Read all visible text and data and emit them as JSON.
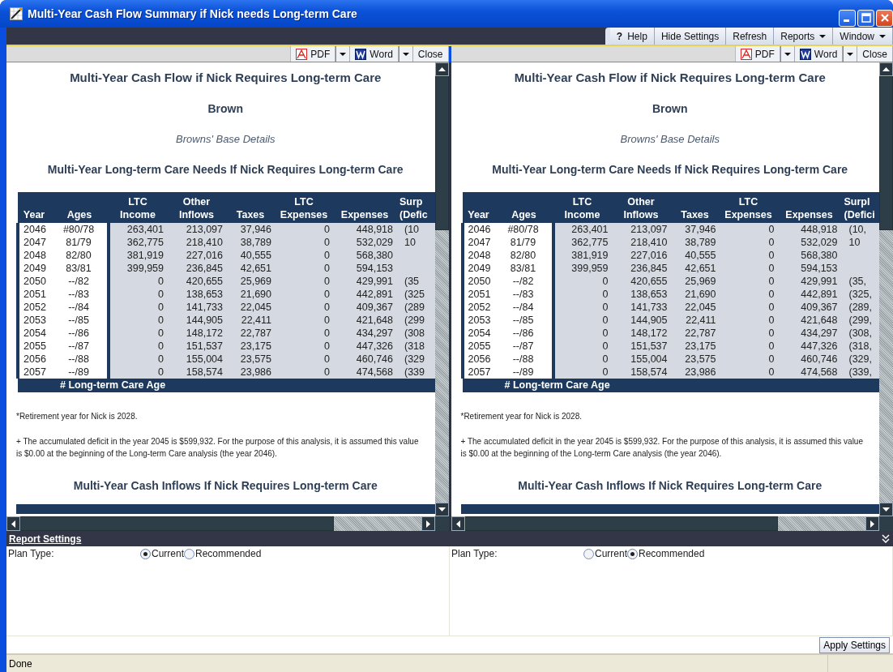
{
  "window": {
    "title": "Multi-Year Cash Flow Summary if Nick needs Long-term Care"
  },
  "menu": [
    {
      "label": "Help",
      "icon": "?",
      "dropdown": false
    },
    {
      "label": "Hide Settings",
      "dropdown": false
    },
    {
      "label": "Refresh",
      "dropdown": false
    },
    {
      "label": "Reports",
      "dropdown": true
    },
    {
      "label": "Window",
      "dropdown": true
    }
  ],
  "panes": [
    {
      "toolbar": [
        {
          "kind": "pdf",
          "label": "PDF"
        },
        {
          "kind": "word",
          "label": "Word"
        },
        {
          "kind": "plain",
          "label": "Close"
        }
      ],
      "report": {
        "title": "Multi-Year Cash Flow if Nick Requires Long-term Care",
        "client": "Brown",
        "subtitle": "Browns' Base Details",
        "section_title": "Multi-Year Long-term Care Needs If Nick Requires Long-term Care",
        "table": {
          "columns": [
            {
              "label": "Year"
            },
            {
              "label": "Ages"
            },
            {
              "top": "LTC",
              "label": "Income"
            },
            {
              "top": "Other",
              "label": "Inflows"
            },
            {
              "label": "Taxes"
            },
            {
              "top": "LTC",
              "label": "Expenses"
            },
            {
              "label": "Expenses"
            },
            {
              "top": "Surp",
              "label": "(Defic"
            }
          ],
          "rows": [
            [
              "2046",
              "#80/78",
              "263,401",
              "213,097",
              "37,946",
              "0",
              "448,918",
              "(10"
            ],
            [
              "2047",
              "81/79",
              "362,775",
              "218,410",
              "38,789",
              "0",
              "532,029",
              "10"
            ],
            [
              "2048",
              "82/80",
              "381,919",
              "227,016",
              "40,555",
              "0",
              "568,380",
              ""
            ],
            [
              "2049",
              "83/81",
              "399,959",
              "236,845",
              "42,651",
              "0",
              "594,153",
              ""
            ],
            [
              "2050",
              "--/82",
              "0",
              "420,655",
              "25,969",
              "0",
              "429,991",
              "(35"
            ],
            [
              "2051",
              "--/83",
              "0",
              "138,653",
              "21,690",
              "0",
              "442,891",
              "(325"
            ],
            [
              "2052",
              "--/84",
              "0",
              "141,733",
              "22,045",
              "0",
              "409,367",
              "(289"
            ],
            [
              "2053",
              "--/85",
              "0",
              "144,905",
              "22,411",
              "0",
              "421,648",
              "(299"
            ],
            [
              "2054",
              "--/86",
              "0",
              "148,172",
              "22,787",
              "0",
              "434,297",
              "(308"
            ],
            [
              "2055",
              "--/87",
              "0",
              "151,537",
              "23,175",
              "0",
              "447,326",
              "(318"
            ],
            [
              "2056",
              "--/88",
              "0",
              "155,004",
              "23,575",
              "0",
              "460,746",
              "(329"
            ],
            [
              "2057",
              "--/89",
              "0",
              "158,574",
              "23,986",
              "0",
              "474,568",
              "(339"
            ]
          ],
          "footer": "# Long-term Care Age"
        },
        "notes": [
          "*Retirement year for Nick is 2028.",
          "+ The accumulated deficit in the year 2045 is $599,932. For the purpose of this analysis, it is assumed this value is $0.00 at the beginning of the Long-term Care analysis (the year 2046)."
        ],
        "next_section_title": "Multi-Year Cash Inflows If Nick Requires Long-term Care"
      },
      "settings": {
        "label": "Plan Type:",
        "options": [
          {
            "label": "Current",
            "selected": true
          },
          {
            "label": "Recommended",
            "selected": false
          }
        ]
      }
    },
    {
      "toolbar": [
        {
          "kind": "pdf",
          "label": "PDF"
        },
        {
          "kind": "word",
          "label": "Word"
        },
        {
          "kind": "plain",
          "label": "Close"
        }
      ],
      "report": {
        "title": "Multi-Year Cash Flow if Nick Requires Long-term Care",
        "client": "Brown",
        "subtitle": "Browns' Base Details",
        "section_title": "Multi-Year Long-term Care Needs If Nick Requires Long-term Care",
        "table": {
          "columns": [
            {
              "label": "Year"
            },
            {
              "label": "Ages"
            },
            {
              "top": "LTC",
              "label": "Income"
            },
            {
              "top": "Other",
              "label": "Inflows"
            },
            {
              "label": "Taxes"
            },
            {
              "top": "LTC",
              "label": "Expenses"
            },
            {
              "label": "Expenses"
            },
            {
              "top": "Surpl",
              "label": "(Defici"
            }
          ],
          "rows": [
            [
              "2046",
              "#80/78",
              "263,401",
              "213,097",
              "37,946",
              "0",
              "448,918",
              "(10,"
            ],
            [
              "2047",
              "81/79",
              "362,775",
              "218,410",
              "38,789",
              "0",
              "532,029",
              "10"
            ],
            [
              "2048",
              "82/80",
              "381,919",
              "227,016",
              "40,555",
              "0",
              "568,380",
              ""
            ],
            [
              "2049",
              "83/81",
              "399,959",
              "236,845",
              "42,651",
              "0",
              "594,153",
              ""
            ],
            [
              "2050",
              "--/82",
              "0",
              "420,655",
              "25,969",
              "0",
              "429,991",
              "(35,"
            ],
            [
              "2051",
              "--/83",
              "0",
              "138,653",
              "21,690",
              "0",
              "442,891",
              "(325,"
            ],
            [
              "2052",
              "--/84",
              "0",
              "141,733",
              "22,045",
              "0",
              "409,367",
              "(289,"
            ],
            [
              "2053",
              "--/85",
              "0",
              "144,905",
              "22,411",
              "0",
              "421,648",
              "(299,"
            ],
            [
              "2054",
              "--/86",
              "0",
              "148,172",
              "22,787",
              "0",
              "434,297",
              "(308,"
            ],
            [
              "2055",
              "--/87",
              "0",
              "151,537",
              "23,175",
              "0",
              "447,326",
              "(318,"
            ],
            [
              "2056",
              "--/88",
              "0",
              "155,004",
              "23,575",
              "0",
              "460,746",
              "(329,"
            ],
            [
              "2057",
              "--/89",
              "0",
              "158,574",
              "23,986",
              "0",
              "474,568",
              "(339,"
            ]
          ],
          "footer": "# Long-term Care Age"
        },
        "notes": [
          "*Retirement year for Nick is 2028.",
          "+ The accumulated deficit in the year 2045 is $599,932. For the purpose of this analysis, it is assumed this value is $0.00 at the beginning of the Long-term Care analysis (the year 2046)."
        ],
        "next_section_title": "Multi-Year Cash Inflows If Nick Requires Long-term Care"
      },
      "settings": {
        "label": "Plan Type:",
        "options": [
          {
            "label": "Current",
            "selected": false
          },
          {
            "label": "Recommended",
            "selected": true
          }
        ]
      }
    }
  ],
  "settings_bar": {
    "title": "Report Settings"
  },
  "apply_button": "Apply Settings",
  "status_bar": {
    "text": "Done"
  }
}
